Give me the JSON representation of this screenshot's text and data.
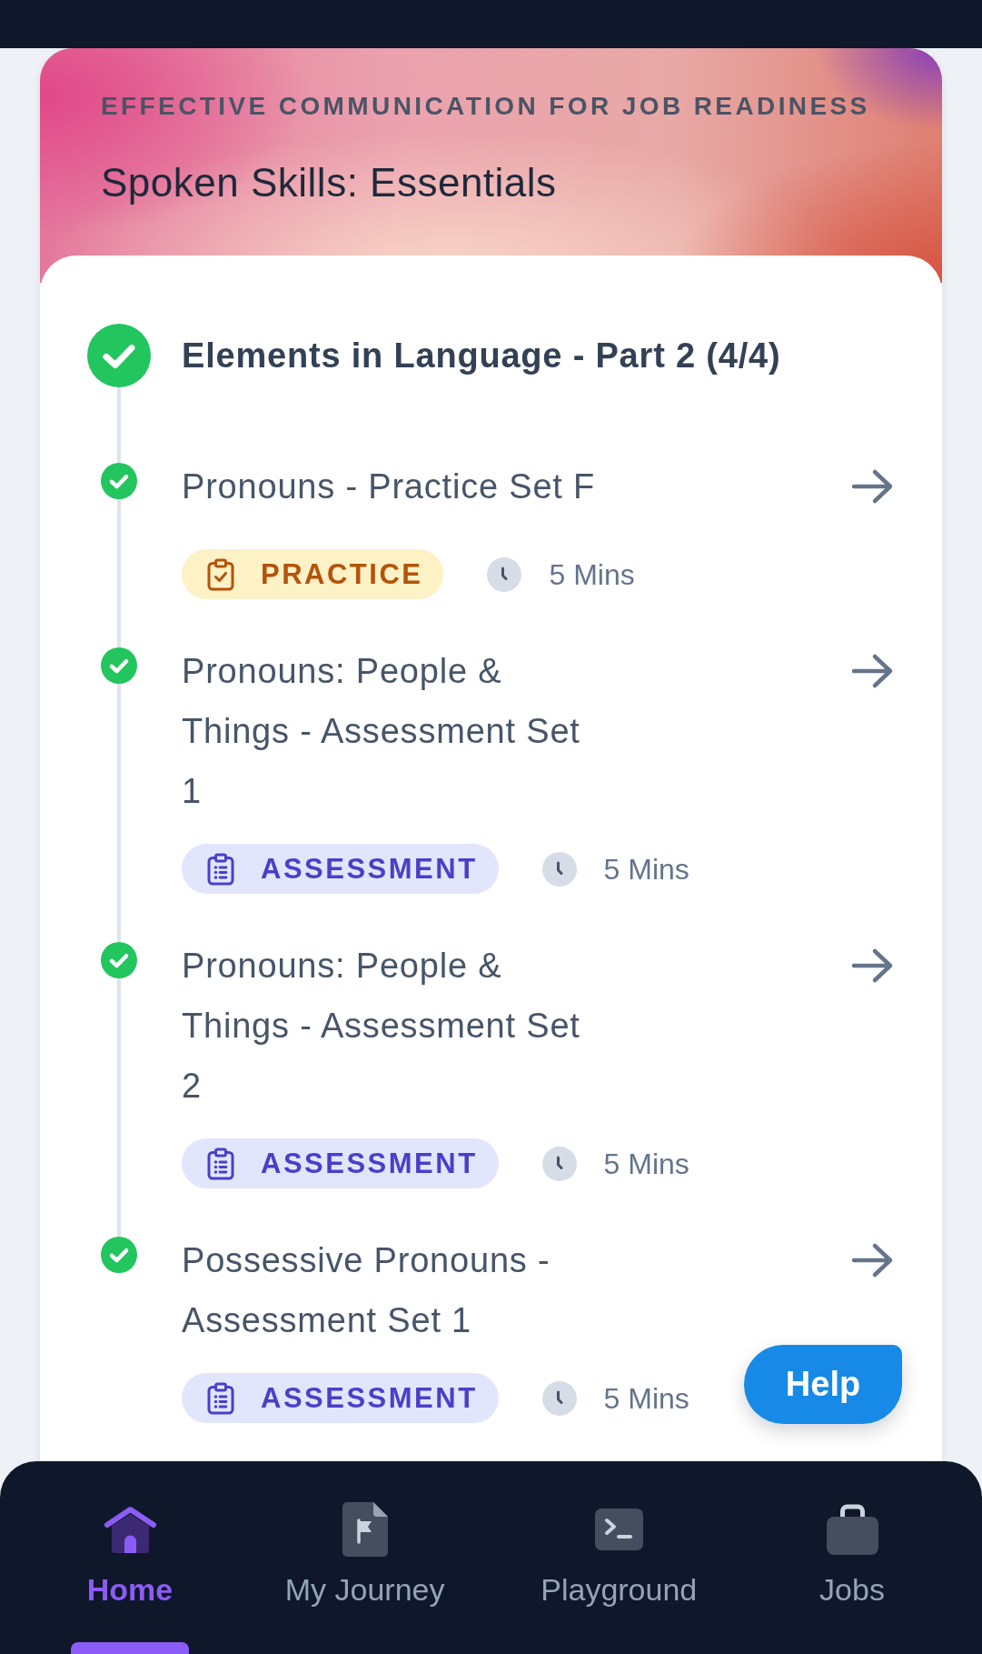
{
  "course": {
    "category": "EFFECTIVE COMMUNICATION FOR JOB READINESS",
    "title": "Spoken Skills: Essentials"
  },
  "module": {
    "title": "Elements in Language - Part 2 (4/4)",
    "completed": true
  },
  "lessons": [
    {
      "title": "Pronouns - Practice Set F",
      "completed": true,
      "kind": "practice",
      "tag": "PRACTICE",
      "duration": "5 Mins"
    },
    {
      "title": "Pronouns: People & Things - Assessment Set 1",
      "completed": true,
      "kind": "assessment",
      "tag": "ASSESSMENT",
      "duration": "5 Mins"
    },
    {
      "title": "Pronouns: People & Things - Assessment Set 2",
      "completed": true,
      "kind": "assessment",
      "tag": "ASSESSMENT",
      "duration": "5 Mins"
    },
    {
      "title": "Possessive Pronouns - Assessment Set 1",
      "completed": true,
      "kind": "assessment",
      "tag": "ASSESSMENT",
      "duration": "5 Mins"
    }
  ],
  "help_button": {
    "label": "Help"
  },
  "bottom_nav": [
    {
      "label": "Home",
      "selected": true
    },
    {
      "label": "My Journey",
      "selected": false
    },
    {
      "label": "Playground",
      "selected": false
    },
    {
      "label": "Jobs",
      "selected": false
    }
  ]
}
